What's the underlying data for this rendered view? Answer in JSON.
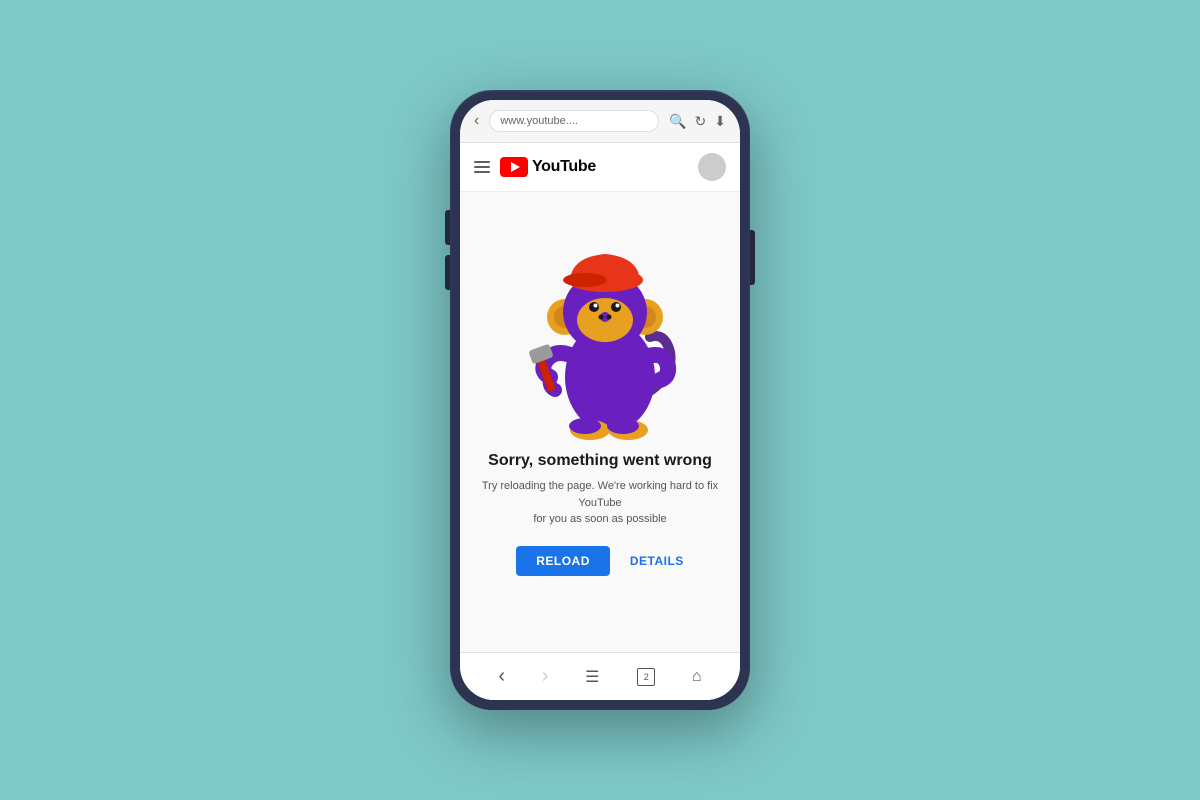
{
  "background_color": "#7ec8c8",
  "phone": {
    "browser": {
      "address": "www.youtube....",
      "back_label": "‹",
      "search_label": "🔍",
      "reload_label": "↻",
      "download_label": "⬇"
    },
    "header": {
      "menu_label": "≡",
      "logo_text": "YouTube",
      "avatar_label": ""
    },
    "error_page": {
      "title": "Sorry, something went wrong",
      "subtitle": "Try reloading the page. We're working hard to fix YouTube\nfor you as soon as possible",
      "reload_button": "RELOAD",
      "details_button": "DETAILS"
    },
    "nav_bar": {
      "back": "‹",
      "forward": "›",
      "menu": "≡",
      "tabs": "2",
      "home": "⌂"
    }
  }
}
